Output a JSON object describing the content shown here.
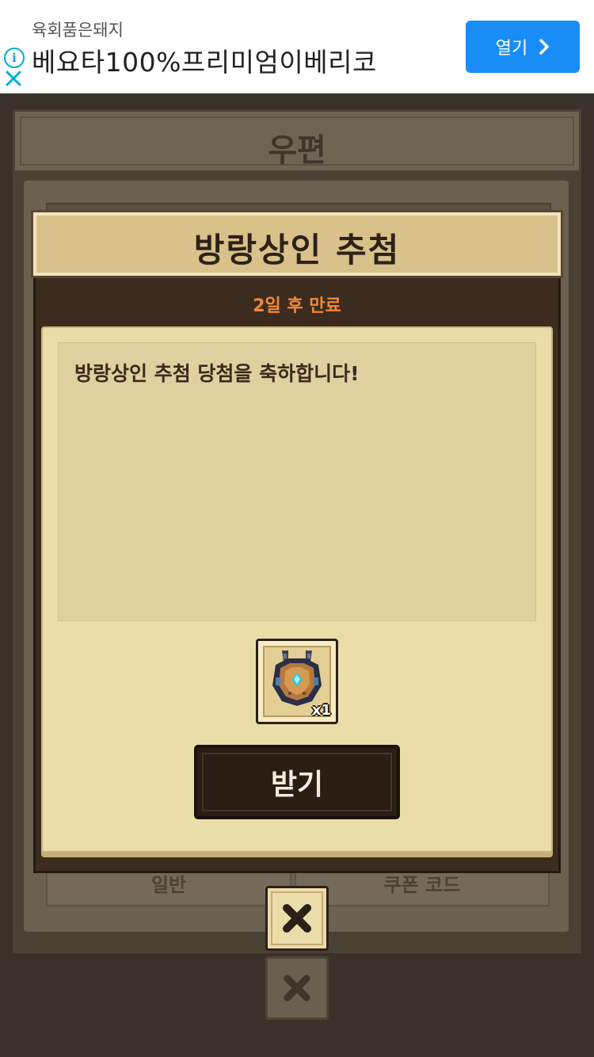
{
  "ad": {
    "subtitle": "육회품은돼지",
    "title": "베요타100%프리미엄이베리코",
    "open_label": "열기",
    "info_icon": "info-icon",
    "close_icon": "close-icon"
  },
  "background": {
    "header_title": "우편",
    "tab_left": "일반",
    "tab_right": "쿠폰 코드"
  },
  "modal": {
    "title": "방랑상인 추첨",
    "expire": "2일 후 만료",
    "message": "방랑상인 추첨 당첨을 축하합니다!",
    "reward": {
      "icon": "shield-item-icon",
      "count": "x1"
    },
    "claim_label": "받기"
  },
  "colors": {
    "ad_button": "#1a8cf6",
    "expire_text": "#f0883a",
    "modal_header": "#d9c18a",
    "content_bg": "#eadda8"
  }
}
